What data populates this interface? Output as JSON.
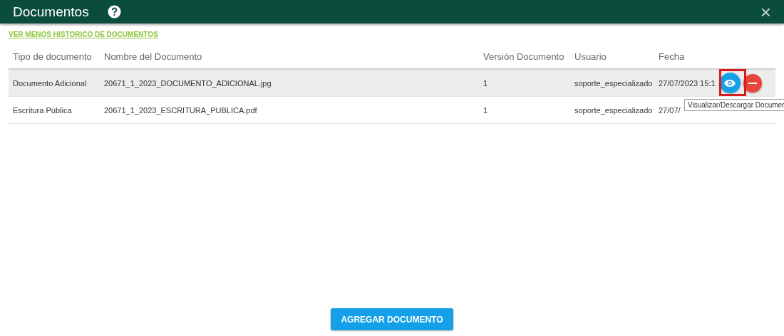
{
  "window": {
    "title": "Documentos",
    "close": "×"
  },
  "history_link": "VER MENOS HISTORICO DE DOCUMENTOS",
  "table": {
    "columns": [
      "Tipo de documento",
      "Nombre del Documento",
      "Versión Documento",
      "Usuario",
      "Fecha"
    ],
    "rows": [
      {
        "cells": [
          "Documento Adicional",
          "20671_1_2023_DOCUMENTO_ADICIONAL.jpg",
          "1",
          "soporte_especializado",
          "27/07/2023 15:1"
        ],
        "selected": true
      },
      {
        "cells": [
          "Escritura Pública",
          "20671_1_2023_ESCRITURA_PUBLICA.pdf",
          "1",
          "soporte_especializado",
          "27/07/"
        ],
        "selected": false
      }
    ]
  },
  "tooltip": "Visualizar/Descargar Documer",
  "add_button": "AGREGAR DOCUMENTO"
}
